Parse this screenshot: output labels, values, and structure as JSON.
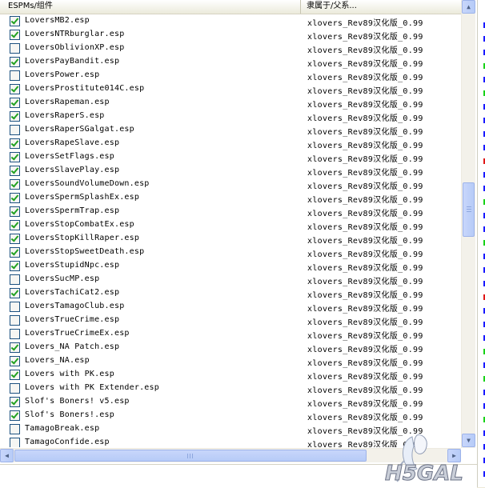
{
  "header": {
    "col_name": "ESPMs/组件",
    "col_master": "隶属于/父系..."
  },
  "rows": [
    {
      "name": "LoversMB2.esp",
      "master": "xlovers_Rev89汉化版_0.99",
      "checked": true
    },
    {
      "name": "LoversNTRburglar.esp",
      "master": "xlovers_Rev89汉化版_0.99",
      "checked": true
    },
    {
      "name": "LoversOblivionXP.esp",
      "master": "xlovers_Rev89汉化版_0.99",
      "checked": false
    },
    {
      "name": "LoversPayBandit.esp",
      "master": "xlovers_Rev89汉化版_0.99",
      "checked": true
    },
    {
      "name": "LoversPower.esp",
      "master": "xlovers_Rev89汉化版_0.99",
      "checked": false
    },
    {
      "name": "LoversProstitute014C.esp",
      "master": "xlovers_Rev89汉化版_0.99",
      "checked": true
    },
    {
      "name": "LoversRapeman.esp",
      "master": "xlovers_Rev89汉化版_0.99",
      "checked": true
    },
    {
      "name": "LoversRaperS.esp",
      "master": "xlovers_Rev89汉化版_0.99",
      "checked": true
    },
    {
      "name": "LoversRaperSGalgat.esp",
      "master": "xlovers_Rev89汉化版_0.99",
      "checked": false
    },
    {
      "name": "LoversRapeSlave.esp",
      "master": "xlovers_Rev89汉化版_0.99",
      "checked": true
    },
    {
      "name": "LoversSetFlags.esp",
      "master": "xlovers_Rev89汉化版_0.99",
      "checked": true
    },
    {
      "name": "LoversSlavePlay.esp",
      "master": "xlovers_Rev89汉化版_0.99",
      "checked": true
    },
    {
      "name": "LoversSoundVolumeDown.esp",
      "master": "xlovers_Rev89汉化版_0.99",
      "checked": true
    },
    {
      "name": "LoversSpermSplashEx.esp",
      "master": "xlovers_Rev89汉化版_0.99",
      "checked": true
    },
    {
      "name": "LoversSpermTrap.esp",
      "master": "xlovers_Rev89汉化版_0.99",
      "checked": true
    },
    {
      "name": "LoversStopCombatEx.esp",
      "master": "xlovers_Rev89汉化版_0.99",
      "checked": true
    },
    {
      "name": "LoversStopKillRaper.esp",
      "master": "xlovers_Rev89汉化版_0.99",
      "checked": true
    },
    {
      "name": "LoversStopSweetDeath.esp",
      "master": "xlovers_Rev89汉化版_0.99",
      "checked": true
    },
    {
      "name": "LoversStupidNpc.esp",
      "master": "xlovers_Rev89汉化版_0.99",
      "checked": true
    },
    {
      "name": "LoversSucMP.esp",
      "master": "xlovers_Rev89汉化版_0.99",
      "checked": false
    },
    {
      "name": "LoversTachiCat2.esp",
      "master": "xlovers_Rev89汉化版_0.99",
      "checked": true
    },
    {
      "name": "LoversTamagoClub.esp",
      "master": "xlovers_Rev89汉化版_0.99",
      "checked": false
    },
    {
      "name": "LoversTrueCrime.esp",
      "master": "xlovers_Rev89汉化版_0.99",
      "checked": false
    },
    {
      "name": "LoversTrueCrimeEx.esp",
      "master": "xlovers_Rev89汉化版_0.99",
      "checked": false
    },
    {
      "name": "Lovers_NA Patch.esp",
      "master": "xlovers_Rev89汉化版_0.99",
      "checked": true
    },
    {
      "name": "Lovers_NA.esp",
      "master": "xlovers_Rev89汉化版_0.99",
      "checked": true
    },
    {
      "name": "Lovers with PK.esp",
      "master": "xlovers_Rev89汉化版_0.99",
      "checked": true
    },
    {
      "name": "Lovers with PK Extender.esp",
      "master": "xlovers_Rev89汉化版_0.99",
      "checked": false
    },
    {
      "name": "Slof's Boners! v5.esp",
      "master": "xlovers_Rev89汉化版_0.99",
      "checked": true
    },
    {
      "name": "Slof's Boners!.esp",
      "master": "xlovers_Rev89汉化版_0.99",
      "checked": true
    },
    {
      "name": "TamagoBreak.esp",
      "master": "xlovers_Rev89汉化版_0.99",
      "checked": false
    },
    {
      "name": "TamagoConfide.esp",
      "master": "xlovers_Rev89汉化版_0.99",
      "checked": false
    }
  ],
  "scroll_icons": {
    "up": "scroll-up-arrow-icon",
    "down": "scroll-down-arrow-icon",
    "left": "scroll-left-arrow-icon",
    "right": "scroll-right-arrow-icon"
  },
  "scroll_glyphs": {
    "up": "▲",
    "down": "▼",
    "left": "◀",
    "right": "▶"
  },
  "colors": {
    "check_green": "#21a121",
    "checkbox_border": "#1c5180",
    "scrollbar_blue": "#b6cbf7"
  },
  "side_strip_colors": [
    "#1a1aff",
    "#1a1aff",
    "#1a1aff",
    "#19d219",
    "#1a1aff",
    "#19d219",
    "#1a1aff",
    "#1a1aff",
    "#1a1aff",
    "#1a1aff",
    "#e01919",
    "#1a1aff",
    "#1a1aff",
    "#19d219",
    "#1a1aff",
    "#1a1aff",
    "#19d219",
    "#1a1aff",
    "#1a1aff",
    "#1a1aff",
    "#e01919",
    "#1a1aff",
    "#1a1aff",
    "#1a1aff",
    "#19d219",
    "#1a1aff",
    "#19d219",
    "#1a1aff",
    "#1a1aff",
    "#19d219",
    "#1a1aff",
    "#1a1aff",
    "#1a1aff",
    "#1a1aff"
  ],
  "watermark": {
    "text": "H5GAL"
  }
}
